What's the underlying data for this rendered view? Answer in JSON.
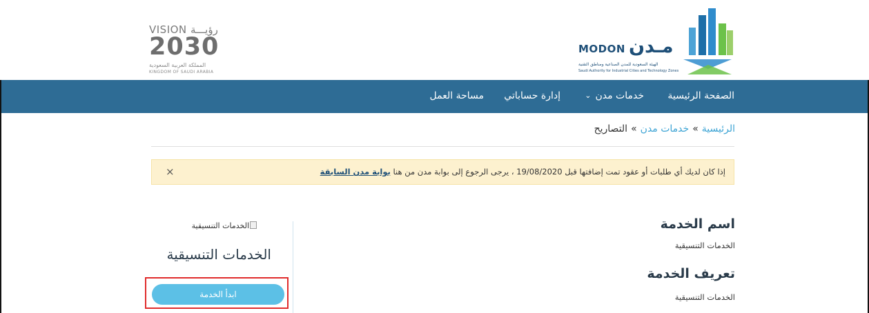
{
  "header": {
    "modon_logo": {
      "arabic": "مـدن",
      "english": "MODON",
      "subtitle_ar": "الهيئة السعودية للمدن الصناعية ومناطق التقنية",
      "subtitle_en": "Saudi Authority for Industrial Cities and Technology Zones"
    },
    "vision_logo": {
      "top": "VISION رؤيـــة",
      "year": "2030",
      "arabic": "المملكة العربية السعودية",
      "english": "KINGDOM OF SAUDI ARABIA"
    }
  },
  "nav": {
    "home": "الصفحة الرئيسية",
    "services": "خدمات مدن",
    "accounts": "إدارة حساباتي",
    "workspace": "مساحة العمل"
  },
  "breadcrumb": {
    "home": "الرئيسية",
    "services": "خدمات مدن",
    "current": "التصاريح",
    "separator": "»"
  },
  "alert": {
    "text": "إذا كان لديك أي طلبات أو عقود تمت إضافتها قبل 19/08/2020 ، يرجى الرجوع إلى بوابة مدن من هنا",
    "link": "بوابة مدن السابقة",
    "close": "×"
  },
  "service": {
    "name_heading": "اسم الخدمة",
    "name_value": "الخدمات التنسيقية",
    "definition_heading": "تعريف الخدمة",
    "definition_value": "الخدمات التنسيقية"
  },
  "side_card": {
    "image_alt": "الخدمات التنسيقية",
    "title": "الخدمات التنسيقية",
    "start_button": "ابدأ الخدمة"
  },
  "colors": {
    "nav_bg": "#2e6c95",
    "accent": "#3ba3d4",
    "button_bg": "#5cc0e6",
    "alert_bg": "#fdf1cf",
    "highlight": "#e02b2b"
  }
}
